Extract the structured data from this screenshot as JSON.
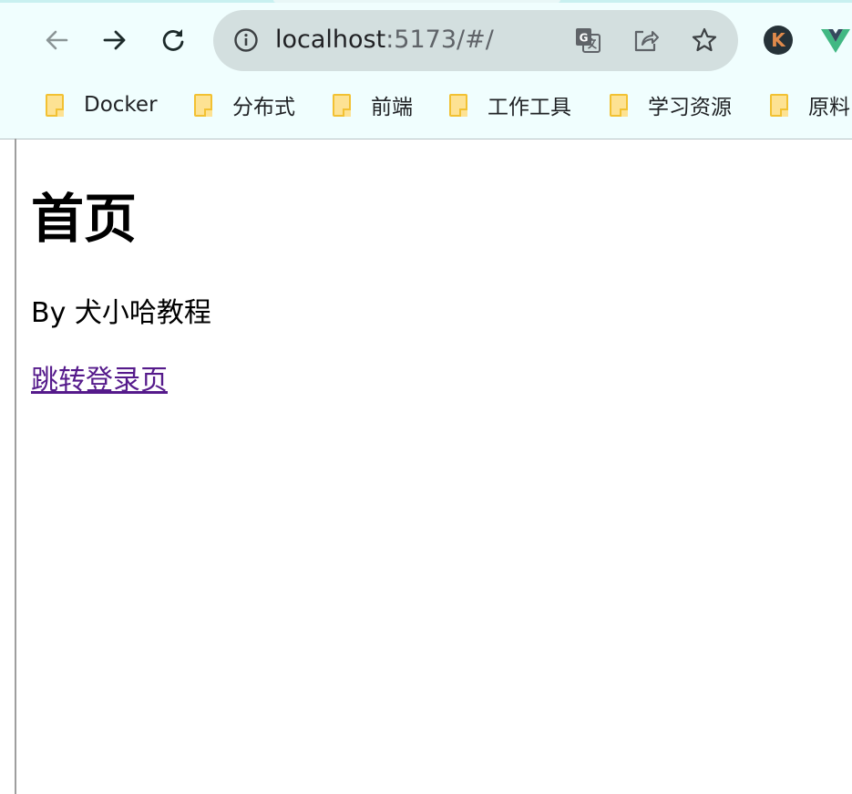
{
  "browser": {
    "address_bar": {
      "host": "localhost",
      "path": ":5173/#/"
    },
    "icons": {
      "back": "back-arrow-icon",
      "forward": "forward-arrow-icon",
      "reload": "reload-icon",
      "site_info": "info-icon",
      "translate": "google-translate-icon",
      "share": "share-icon",
      "bookmark_star": "star-icon",
      "extension_1": "k-avatar-icon",
      "extension_2": "vue-devtools-icon"
    },
    "extension_avatar_letter": "K",
    "bookmarks": [
      {
        "label": "Docker"
      },
      {
        "label": "分布式"
      },
      {
        "label": "前端"
      },
      {
        "label": "工作工具"
      },
      {
        "label": "学习资源"
      },
      {
        "label": "原料"
      }
    ],
    "colors": {
      "toolbar_bg": "#f0fefe",
      "omnibox_bg": "#d3dfdf",
      "folder_fill": "#fde293",
      "link_visited": "#551a8b",
      "vue_green": "#41b883",
      "vue_dark": "#35495e"
    }
  },
  "page": {
    "heading": "首页",
    "byline": "By 犬小哈教程",
    "link_text": "跳转登录页"
  }
}
